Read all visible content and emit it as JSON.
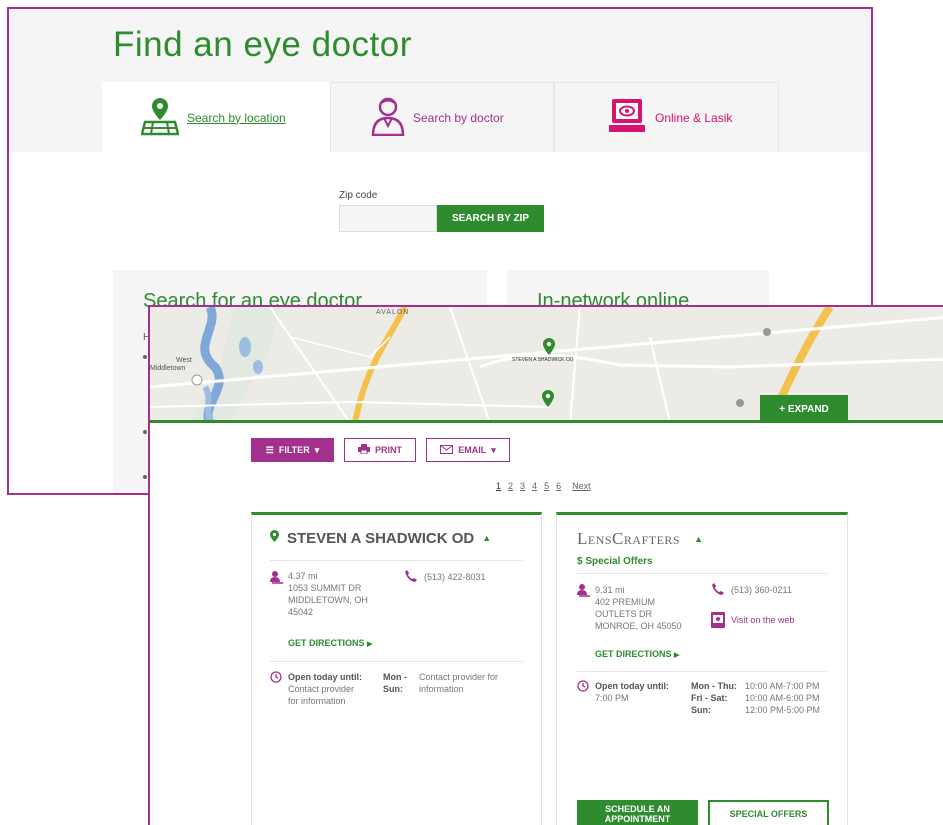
{
  "back": {
    "title": "Find an eye doctor",
    "tabs": [
      {
        "label": "Search by location",
        "icon": "map-pin-icon"
      },
      {
        "label": "Search by doctor",
        "icon": "doctor-icon"
      },
      {
        "label": "Online & Lasik",
        "icon": "laptop-eye-icon"
      }
    ],
    "zip_label": "Zip code",
    "zip_value": "",
    "zip_button": "SEARCH BY ZIP",
    "box1_title": "Search for an eye doctor",
    "box1_letter": "H",
    "box2_title": "In-network online"
  },
  "map": {
    "label_avalon": "AVALON",
    "label_west": "West",
    "label_middletown": "Middletown",
    "label_marker": "STEVEN A SHADWICK OD",
    "expand": "+ EXPAND"
  },
  "toolbar": {
    "filter": "FILTER",
    "print": "PRINT",
    "email": "EMAIL"
  },
  "pager": {
    "pages": [
      "1",
      "2",
      "3",
      "4",
      "5",
      "6"
    ],
    "next": "Next"
  },
  "card1": {
    "name": "STEVEN A SHADWICK OD",
    "distance": "4.37 mi",
    "address1": "1053 SUMMIT DR",
    "address2": "MIDDLETOWN, OH",
    "address3": "45042",
    "phone": "(513) 422-8031",
    "directions": "GET DIRECTIONS",
    "open_label": "Open today until:",
    "open_value1": "Contact provider",
    "open_value2": "for information",
    "days1": "Mon -",
    "days2": "Sun:",
    "hours1": "Contact provider for",
    "hours2": "information"
  },
  "card2": {
    "brand": "LensCrafters",
    "offers": "$ Special Offers",
    "distance": "9.31 mi",
    "address1": "402 PREMIUM",
    "address2": "OUTLETS DR",
    "address3": "MONROE, OH 45050",
    "phone": "(513) 360-0211",
    "web": "Visit on the web",
    "directions": "GET DIRECTIONS",
    "open_label": "Open today until:",
    "open_value": "7:00 PM",
    "hours": [
      {
        "days": "Mon - Thu:",
        "time": "10:00 AM-7:00 PM"
      },
      {
        "days": "Fri - Sat:",
        "time": "10:00 AM-6:00 PM"
      },
      {
        "days": "Sun:",
        "time": "12:00 PM-5:00 PM"
      }
    ],
    "schedule1": "SCHEDULE AN",
    "schedule2": "APPOINTMENT",
    "special": "SPECIAL OFFERS"
  },
  "colors": {
    "green": "#2e8b2e",
    "purple": "#a1318c",
    "pink": "#d6136e"
  }
}
